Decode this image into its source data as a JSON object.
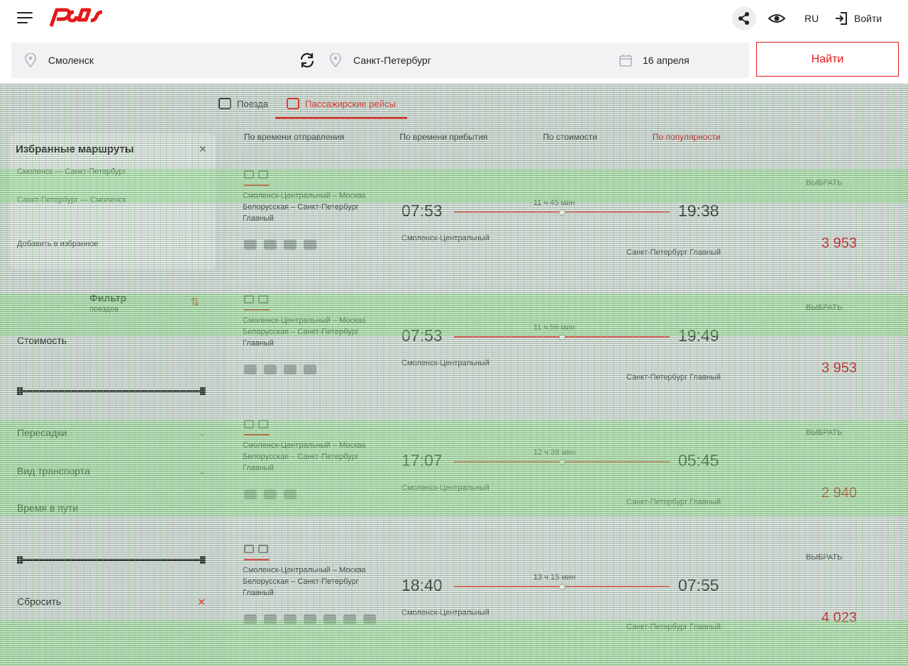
{
  "header": {
    "lang": "RU",
    "login_label": "Войти",
    "brand_color": "#e21a1a"
  },
  "search": {
    "from": "Смоленск",
    "to": "Санкт-Петербург",
    "date": "16 апреля",
    "find_label": "Найти"
  },
  "tabs": [
    {
      "label": "Поезда",
      "active": false
    },
    {
      "label": "Пассажирские рейсы",
      "active": true
    }
  ],
  "sort_options": [
    "По времени отправления",
    "По времени прибытия",
    "По стоимости",
    "По популярности"
  ],
  "sidebar": {
    "title": "Избранные маршруты",
    "lines": [
      "Смоленск — Санкт-Петербург",
      "Санкт-Петербург — Смоленск",
      "Добавить в избранное"
    ],
    "filter_title": "Фильтр",
    "filter_subtitle": "поездов",
    "groups": [
      "Стоимость",
      "Пересадки",
      "Вид транспорта",
      "Время в пути"
    ],
    "reset_label": "Сбросить"
  },
  "trips": [
    {
      "route": "Смоленск-Центральный – Москва Белорусская – Санкт-Петербург Главный",
      "dep_time": "07:53",
      "arr_time": "19:38",
      "duration": "11 ч 45 мин",
      "dep_station": "Смоленск-Центральный",
      "arr_station": "Санкт-Петербург Главный",
      "choose": "ВЫБРАТЬ",
      "price": "3 953"
    },
    {
      "route": "Смоленск-Центральный – Москва Белорусская – Санкт-Петербург Главный",
      "dep_time": "07:53",
      "arr_time": "19:49",
      "duration": "11 ч 56 мин",
      "dep_station": "Смоленск-Центральный",
      "arr_station": "Санкт-Петербург Главный",
      "choose": "ВЫБРАТЬ",
      "price": "3 953"
    },
    {
      "route": "Смоленск-Центральный – Москва Белорусская – Санкт-Петербург Главный",
      "dep_time": "17:07",
      "arr_time": "05:45",
      "duration": "12 ч 38 мин",
      "dep_station": "Смоленск-Центральный",
      "arr_station": "Санкт-Петербург Главный",
      "choose": "ВЫБРАТЬ",
      "price": "2 940"
    },
    {
      "route": "Смоленск-Центральный – Москва Белорусская – Санкт-Петербург Главный",
      "dep_time": "18:40",
      "arr_time": "07:55",
      "duration": "13 ч 15 мин",
      "dep_station": "Смоленск-Центральный",
      "arr_station": "Санкт-Петербург Главный",
      "choose": "ВЫБРАТЬ",
      "price": "4 023"
    }
  ]
}
